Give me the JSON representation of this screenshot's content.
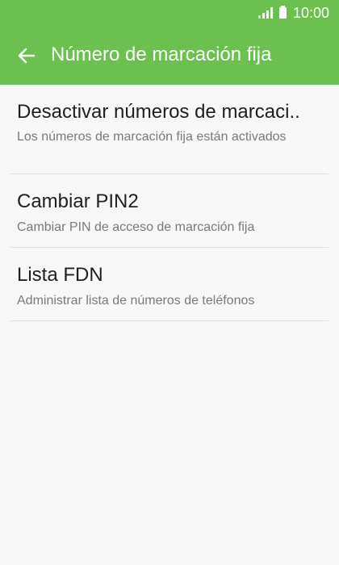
{
  "status_bar": {
    "time": "10:00",
    "signal_icon": "signal-icon",
    "battery_icon": "battery-icon"
  },
  "header": {
    "title": "Número de marcación fija",
    "back_icon": "back-arrow-icon",
    "color": "#6cc04f"
  },
  "items": [
    {
      "title": "Desactivar números de marcaci..",
      "subtitle": "Los números de marcación fija están activados"
    },
    {
      "title": "Cambiar PIN2",
      "subtitle": "Cambiar PIN de acceso de marcación fija"
    },
    {
      "title": "Lista FDN",
      "subtitle": "Administrar lista de números de teléfonos"
    }
  ]
}
